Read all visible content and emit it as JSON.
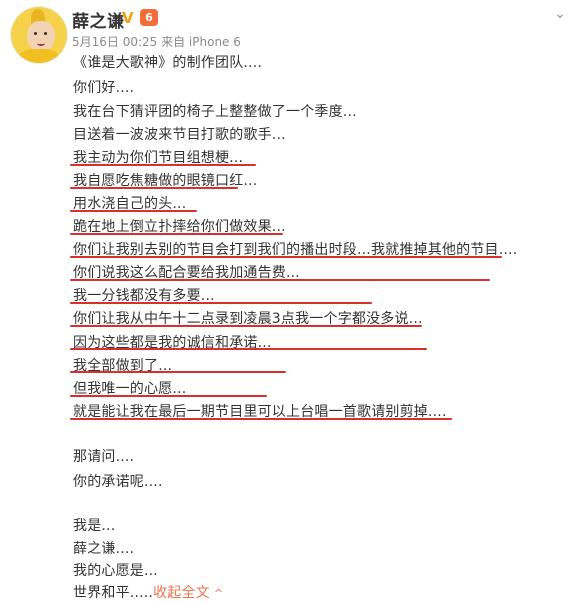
{
  "post": {
    "username": "薛之谦",
    "verified_badge": "V",
    "vip_badge": "6",
    "meta": "5月16日 00:25 来自 iPhone 6",
    "lines": [
      "《谁是大歌神》的制作团队....",
      "你们好....",
      "我在台下猜评团的椅子上整整做了一个季度...",
      "目送着一波波来节目打歌的歌手...",
      "我主动为你们节目组想梗...",
      "我自愿吃焦糖做的眼镜口红...",
      "用水浇自己的头...",
      "跪在地上倒立扑摔给你们做效果...",
      "你们让我别去别的节目会打到我们的播出时段...我就推掉其他的节目....",
      "你们说我这么配合要给我加通告费...",
      "我一分钱都没有多要...",
      "你们让我从中午十二点录到凌晨3点我一个字都没多说...",
      "因为这些都是我的诚信和承诺...",
      "我全部做到了...",
      "但我唯一的心愿...",
      "就是能让我在最后一期节目里可以上台唱一首歌请别剪掉....",
      "那请问....",
      "你的承诺呢....",
      "我是...",
      "薛之谦....",
      "我的心愿是...",
      "世界和平....."
    ],
    "collapse_label": "收起全文",
    "collapse_icon": "up-arrow-icon"
  },
  "colors": {
    "accent_link": "#eb7350",
    "underline_red": "#d9302c",
    "vip_orange": "#f56c3a",
    "verified_gold": "#f4a20c"
  }
}
